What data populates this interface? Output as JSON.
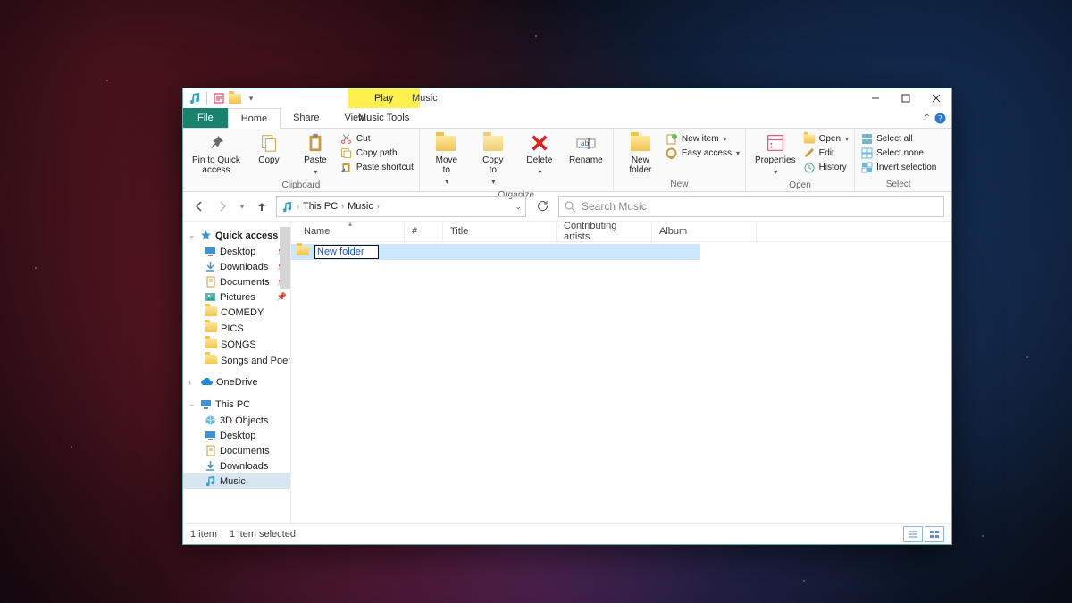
{
  "titlebar": {
    "context_tab": "Play",
    "window_title": "Music"
  },
  "tabs": {
    "file": "File",
    "home": "Home",
    "share": "Share",
    "view": "View",
    "context_tools": "Music Tools"
  },
  "ribbon": {
    "clipboard": {
      "label": "Clipboard",
      "pin": "Pin to Quick\naccess",
      "copy": "Copy",
      "paste": "Paste",
      "cut": "Cut",
      "copy_path": "Copy path",
      "paste_shortcut": "Paste shortcut"
    },
    "organize": {
      "label": "Organize",
      "move_to": "Move\nto",
      "copy_to": "Copy\nto",
      "delete": "Delete",
      "rename": "Rename"
    },
    "new": {
      "label": "New",
      "new_folder": "New\nfolder",
      "new_item": "New item",
      "easy_access": "Easy access"
    },
    "open": {
      "label": "Open",
      "properties": "Properties",
      "open": "Open",
      "edit": "Edit",
      "history": "History"
    },
    "select": {
      "label": "Select",
      "select_all": "Select all",
      "select_none": "Select none",
      "invert": "Invert selection"
    }
  },
  "breadcrumb": {
    "seg1": "This PC",
    "seg2": "Music"
  },
  "search": {
    "placeholder": "Search Music"
  },
  "columns": {
    "name": "Name",
    "num": "#",
    "title": "Title",
    "artists": "Contributing artists",
    "album": "Album"
  },
  "sidebar": {
    "quick_access": "Quick access",
    "items_qa": [
      {
        "label": "Desktop",
        "icon": "desktop"
      },
      {
        "label": "Downloads",
        "icon": "download"
      },
      {
        "label": "Documents",
        "icon": "document"
      },
      {
        "label": "Pictures",
        "icon": "picture"
      },
      {
        "label": "COMEDY",
        "icon": "folder"
      },
      {
        "label": "PICS",
        "icon": "folder"
      },
      {
        "label": "SONGS",
        "icon": "folder"
      },
      {
        "label": "Songs and Poem",
        "icon": "folder"
      }
    ],
    "onedrive": "OneDrive",
    "this_pc": "This PC",
    "items_pc": [
      {
        "label": "3D Objects",
        "icon": "3d"
      },
      {
        "label": "Desktop",
        "icon": "desktop"
      },
      {
        "label": "Documents",
        "icon": "document"
      },
      {
        "label": "Downloads",
        "icon": "download"
      },
      {
        "label": "Music",
        "icon": "music",
        "selected": true
      }
    ]
  },
  "file_row": {
    "editing_name": "New folder"
  },
  "status": {
    "count": "1 item",
    "selected": "1 item selected"
  }
}
